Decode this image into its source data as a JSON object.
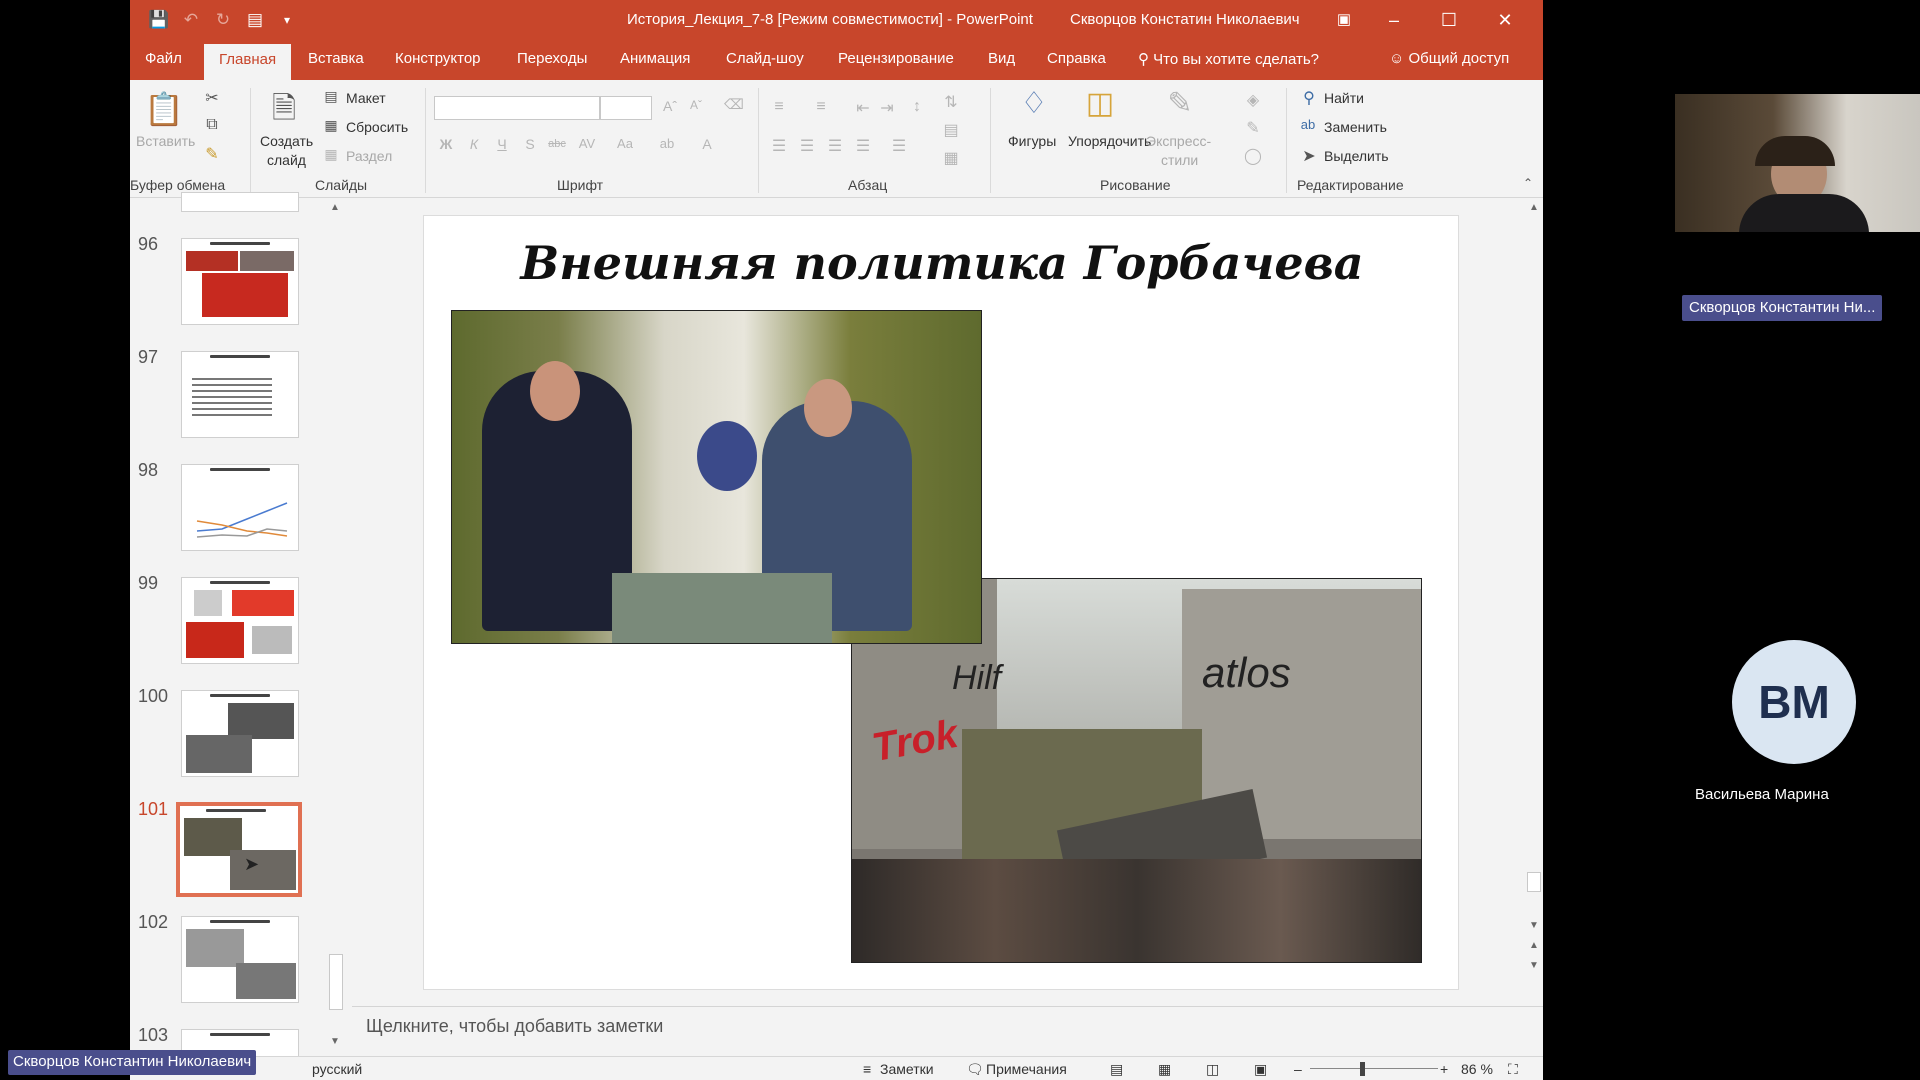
{
  "window": {
    "title": "История_Лекция_7-8 [Режим совместимости] - PowerPoint",
    "user": "Скворцов Констатин Николаевич"
  },
  "tabs": [
    {
      "label": "Файл"
    },
    {
      "label": "Главная"
    },
    {
      "label": "Вставка"
    },
    {
      "label": "Конструктор"
    },
    {
      "label": "Переходы"
    },
    {
      "label": "Анимация"
    },
    {
      "label": "Слайд-шоу"
    },
    {
      "label": "Рецензирование"
    },
    {
      "label": "Вид"
    },
    {
      "label": "Справка"
    }
  ],
  "tell_me": "Что вы хотите сделать?",
  "share": "Общий доступ",
  "ribbon": {
    "clipboard": {
      "label": "Буфер обмена",
      "paste": "Вставить"
    },
    "slides": {
      "label": "Слайды",
      "new_slide_1": "Создать",
      "new_slide_2": "слайд",
      "layout": "Макет",
      "reset": "Сбросить",
      "section": "Раздел"
    },
    "font": {
      "label": "Шрифт"
    },
    "paragraph": {
      "label": "Абзац"
    },
    "drawing": {
      "label": "Рисование",
      "shapes": "Фигуры",
      "arrange": "Упорядочить",
      "quick_styles_1": "Экспресс-",
      "quick_styles_2": "стили"
    },
    "editing": {
      "label": "Редактирование",
      "find": "Найти",
      "replace": "Заменить",
      "select": "Выделить"
    }
  },
  "thumbnails": [
    {
      "number": "96"
    },
    {
      "number": "97"
    },
    {
      "number": "98"
    },
    {
      "number": "99"
    },
    {
      "number": "100"
    },
    {
      "number": "101"
    },
    {
      "number": "102"
    },
    {
      "number": "103"
    }
  ],
  "slide": {
    "title": "Внешняя политика Горбачева",
    "photo1": "Reagan and Gorbachev seated meeting photo",
    "photo2": "Berlin Wall opening photo"
  },
  "notes_placeholder": "Щелкните, чтобы добавить заметки",
  "status": {
    "language": "русский",
    "notes": "Заметки",
    "comments": "Примечания",
    "zoom": "86 %"
  },
  "meeting": {
    "presenter_tag": "Скворцов Константин Ни...",
    "avatar_initials": "ВМ",
    "participant_name": "Васильева Марина",
    "bottom_tag": "Скворцов Константин Николаевич"
  }
}
